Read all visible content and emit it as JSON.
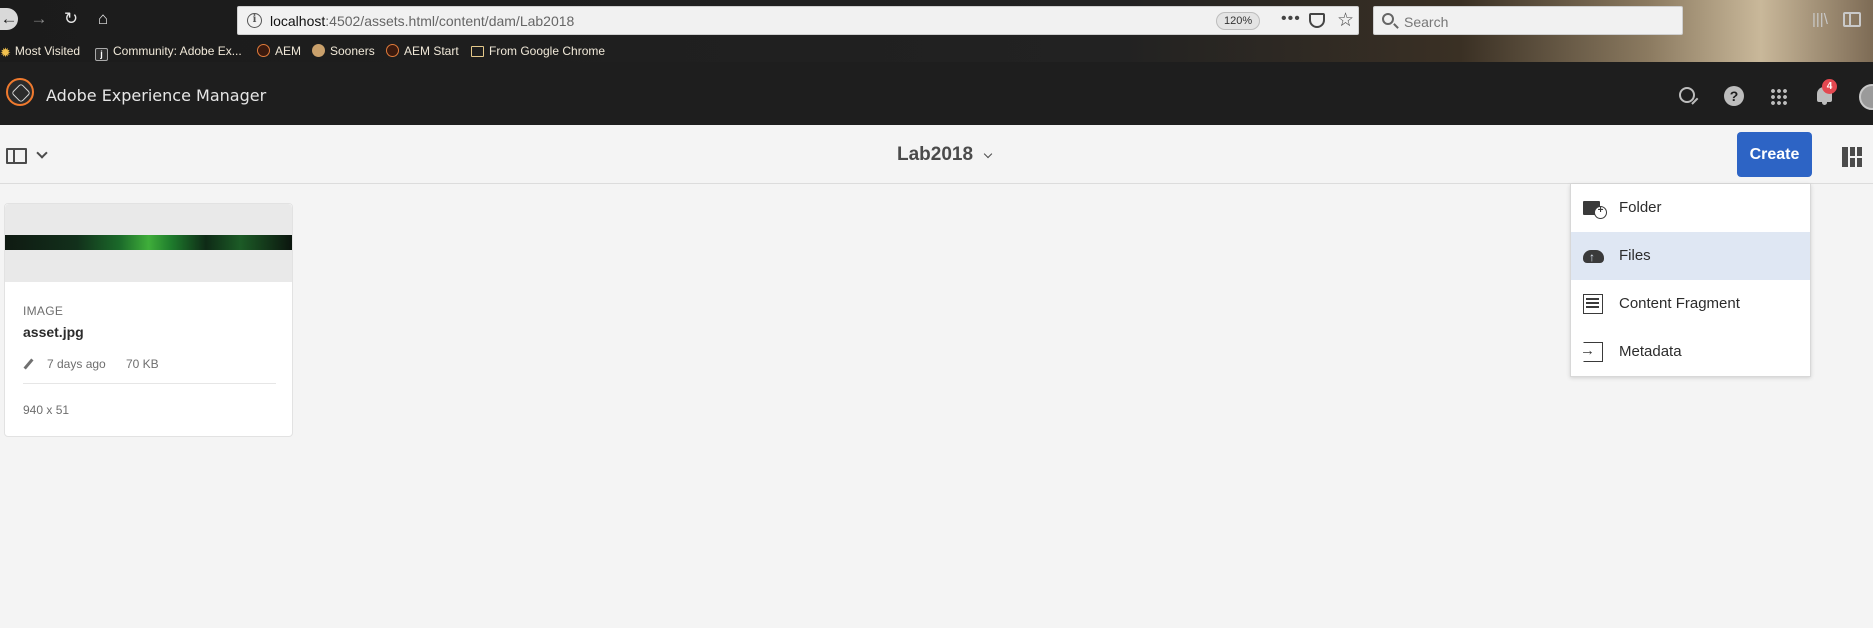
{
  "browser": {
    "url_host": "localhost",
    "url_path": ":4502/assets.html/content/dam/Lab2018",
    "zoom": "120%",
    "search_placeholder": "Search",
    "bookmarks": [
      {
        "label": "Most Visited",
        "icon": "gear-icon"
      },
      {
        "label": "Community: Adobe Ex...",
        "icon": "community-icon"
      },
      {
        "label": "AEM",
        "icon": "aem-icon"
      },
      {
        "label": "Sooners",
        "icon": "sooners-icon"
      },
      {
        "label": "AEM Start",
        "icon": "aem-icon"
      },
      {
        "label": "From Google Chrome",
        "icon": "folder-icon"
      }
    ]
  },
  "shell": {
    "app_title": "Adobe Experience Manager",
    "notification_count": "4"
  },
  "action_bar": {
    "folder_title": "Lab2018",
    "create_label": "Create"
  },
  "asset": {
    "type": "IMAGE",
    "name": "asset.jpg",
    "modified": "7 days ago",
    "size": "70 KB",
    "dimensions": "940 x 51"
  },
  "create_menu": {
    "items": [
      {
        "label": "Folder",
        "icon": "folder-add-icon",
        "highlighted": false
      },
      {
        "label": "Files",
        "icon": "cloud-upload-icon",
        "highlighted": true
      },
      {
        "label": "Content Fragment",
        "icon": "content-fragment-icon",
        "highlighted": false
      },
      {
        "label": "Metadata",
        "icon": "import-metadata-icon",
        "highlighted": false
      }
    ]
  },
  "colors": {
    "accent": "#2d64c5",
    "shell_bg": "#1e1e1e",
    "menu_highlight": "#dfe7f3",
    "badge": "#e34850"
  }
}
